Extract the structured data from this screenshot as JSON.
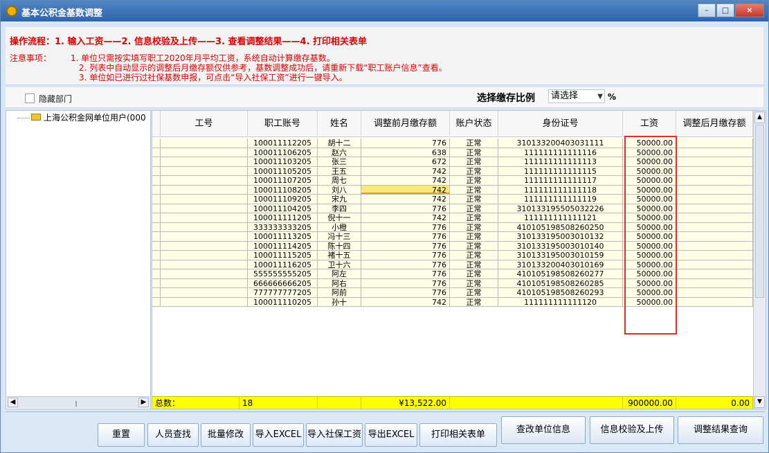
{
  "window": {
    "title": "基本公积金基数调整",
    "buttons": {
      "minimize": "–",
      "maximize": "□",
      "close": "×"
    }
  },
  "notice": {
    "process": "操作流程：1. 输入工资——2. 信息校验及上传——3. 查看调整结果——4. 打印相关表单",
    "note_title": "注意事项：",
    "lines": [
      "1. 单位只需按实填写职工2020年月平均工资，系统自动计算缴存基数。",
      "2. 列表中自动显示的调整后月缴存额仅供参考，基数调整成功后，请重新下载“职工账户信息”查看。",
      "3. 单位如已进行过社保基数申报，可点击“导入社保工资”进行一键导入。"
    ]
  },
  "filters": {
    "hide_dept_label": "隐藏部门",
    "ratio_label": "选择缴存比例",
    "ratio_placeholder": "请选择",
    "percent": "%"
  },
  "tree": {
    "root_label": "上海公积金网单位用户(000"
  },
  "table": {
    "headers": [
      "工号",
      "职工账号",
      "姓名",
      "调整前月缴存额",
      "账户状态",
      "身份证号",
      "工资",
      "调整后月缴存额"
    ],
    "rows": [
      [
        "",
        "100011112205",
        "胡十二",
        "776",
        "正常",
        "310133200403031111",
        "50000.00",
        ""
      ],
      [
        "",
        "100011106205",
        "赵六",
        "638",
        "正常",
        "111111111111116",
        "50000.00",
        ""
      ],
      [
        "",
        "100011103205",
        "张三",
        "672",
        "正常",
        "111111111111113",
        "50000.00",
        ""
      ],
      [
        "",
        "100011105205",
        "王五",
        "742",
        "正常",
        "111111111111115",
        "50000.00",
        ""
      ],
      [
        "",
        "100011107205",
        "周七",
        "742",
        "正常",
        "111111111111117",
        "50000.00",
        ""
      ],
      [
        "",
        "100011108205",
        "刘八",
        "742",
        "正常",
        "111111111111118",
        "50000.00",
        ""
      ],
      [
        "",
        "100011109205",
        "宋九",
        "742",
        "正常",
        "111111111111119",
        "50000.00",
        ""
      ],
      [
        "",
        "100011104205",
        "李四",
        "776",
        "正常",
        "310133195505032226",
        "50000.00",
        ""
      ],
      [
        "",
        "100011111205",
        "倪十一",
        "742",
        "正常",
        "111111111111121",
        "50000.00",
        ""
      ],
      [
        "",
        "333333333205",
        "小橙",
        "776",
        "正常",
        "410105198508260250",
        "50000.00",
        ""
      ],
      [
        "",
        "100011113205",
        "冯十三",
        "776",
        "正常",
        "310133195003010132",
        "50000.00",
        ""
      ],
      [
        "",
        "100011114205",
        "陈十四",
        "776",
        "正常",
        "310133195003010140",
        "50000.00",
        ""
      ],
      [
        "",
        "100011115205",
        "褚十五",
        "776",
        "正常",
        "310133195003010159",
        "50000.00",
        ""
      ],
      [
        "",
        "100011116205",
        "卫十六",
        "776",
        "正常",
        "310133200403010169",
        "50000.00",
        ""
      ],
      [
        "",
        "555555555205",
        "阿左",
        "776",
        "正常",
        "410105198508260277",
        "50000.00",
        ""
      ],
      [
        "",
        "666666666205",
        "阿右",
        "776",
        "正常",
        "410105198508260285",
        "50000.00",
        ""
      ],
      [
        "",
        "777777777205",
        "阿前",
        "776",
        "正常",
        "410105198508260293",
        "50000.00",
        ""
      ],
      [
        "",
        "100011110205",
        "孙十",
        "742",
        "正常",
        "111111111111120",
        "50000.00",
        ""
      ]
    ],
    "highlight_row": 5,
    "totals": {
      "label": "总数：",
      "count": "18",
      "before_sum": "¥13,522.00",
      "salary_sum": "900000.00",
      "after_sum": "0.00"
    }
  },
  "buttons": {
    "reset": "重置",
    "search_person": "人员查找",
    "batch_modify": "批量修改",
    "import_excel": "导入EXCEL",
    "import_social": "导入社保工资",
    "export_excel": "导出EXCEL",
    "print_forms": "打印相关表单",
    "change_unit": "查改单位信息",
    "verify_upload": "信息校验及上传",
    "query_result": "调整结果查询"
  }
}
